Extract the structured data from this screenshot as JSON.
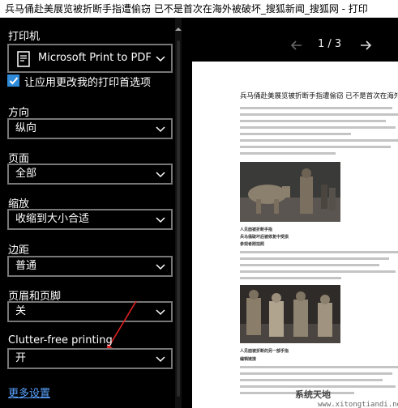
{
  "window": {
    "title": "兵马俑赴美展览被折断手指遭偷窃 已不是首次在海外被破坏_搜狐新闻_搜狐网 - 打印"
  },
  "sidebar": {
    "printer_label": "打印机",
    "printer_value": "Microsoft Print to PDF",
    "app_settings_label": "让应用更改我的打印首选项",
    "app_settings_checked": true,
    "orientation_label": "方向",
    "orientation_value": "纵向",
    "pages_label": "页面",
    "pages_value": "全部",
    "scale_label": "缩放",
    "scale_value": "收缩到大小合适",
    "margins_label": "边距",
    "margins_value": "普通",
    "headers_label": "页眉和页脚",
    "headers_value": "关",
    "clutter_label": "Clutter-free printing",
    "clutter_value": "开",
    "more_settings": "更多设置"
  },
  "preview": {
    "page_indicator": "1 / 3",
    "article_title": "兵马俑赴美展览被折断手指遭偷窃 已不是首次在海外",
    "caption1": "人见面被折断手指",
    "caption2": "兵马俑破坏后被修复中受损",
    "caption3": "参观者刚拍照",
    "caption4": "人见面被折断的另一部手指",
    "caption5": "编辑链接"
  },
  "watermark": {
    "brand": "系统天地",
    "site": "www.xitongtiandi.net"
  },
  "colors": {
    "accent": "#2f8ad8",
    "link": "#5aa3ff"
  }
}
